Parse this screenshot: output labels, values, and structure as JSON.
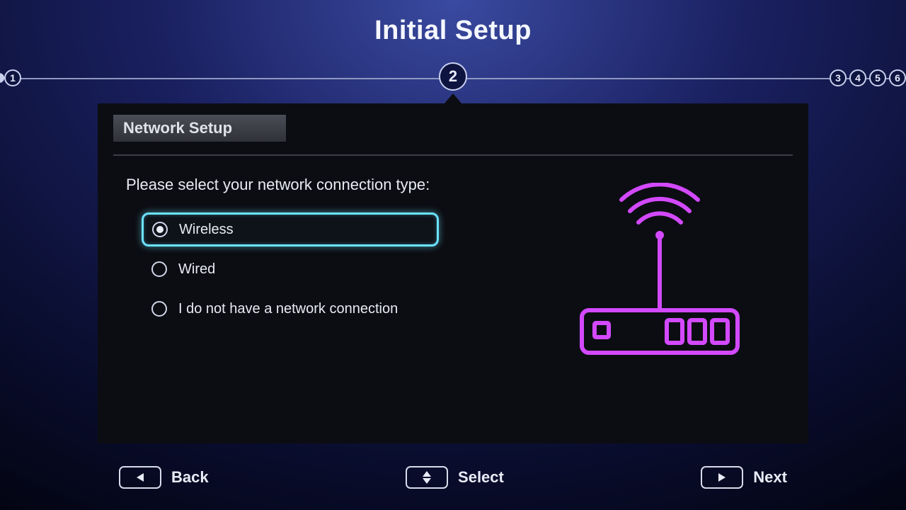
{
  "title": "Initial Setup",
  "steps": {
    "total": 6,
    "current": 2
  },
  "panel": {
    "heading": "Network Setup",
    "prompt": "Please select your network connection type:",
    "options": [
      {
        "label": "Wireless",
        "selected": true
      },
      {
        "label": "Wired",
        "selected": false
      },
      {
        "label": "I do not have a network connection",
        "selected": false
      }
    ]
  },
  "illustration": {
    "name": "wireless-router-icon",
    "color": "#d349ff"
  },
  "footer": {
    "back": "Back",
    "select": "Select",
    "next": "Next"
  }
}
